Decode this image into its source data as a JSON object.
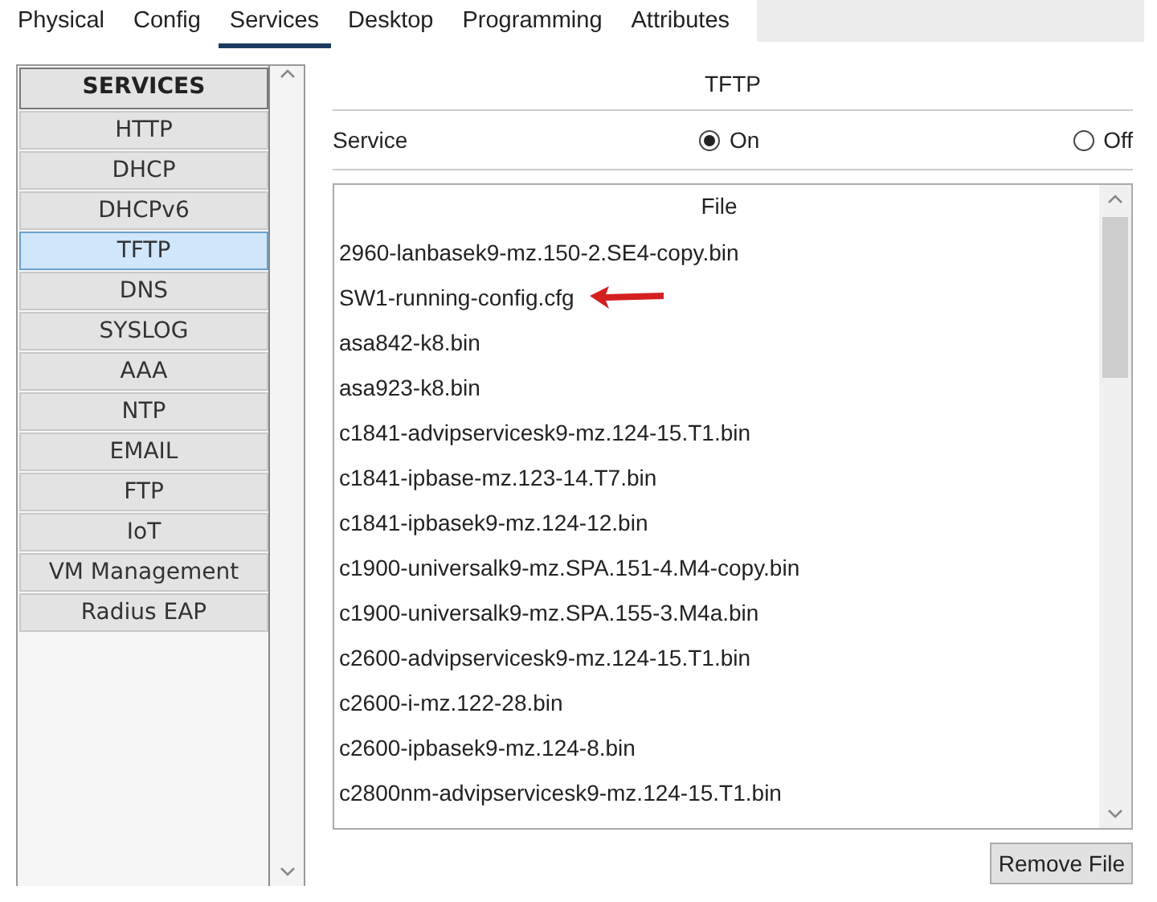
{
  "tabs": [
    {
      "label": "Physical",
      "selected": false
    },
    {
      "label": "Config",
      "selected": false
    },
    {
      "label": "Services",
      "selected": true
    },
    {
      "label": "Desktop",
      "selected": false
    },
    {
      "label": "Programming",
      "selected": false
    },
    {
      "label": "Attributes",
      "selected": false
    }
  ],
  "sidebar": {
    "heading": "SERVICES",
    "items": [
      {
        "label": "HTTP",
        "selected": false
      },
      {
        "label": "DHCP",
        "selected": false
      },
      {
        "label": "DHCPv6",
        "selected": false
      },
      {
        "label": "TFTP",
        "selected": true
      },
      {
        "label": "DNS",
        "selected": false
      },
      {
        "label": "SYSLOG",
        "selected": false
      },
      {
        "label": "AAA",
        "selected": false
      },
      {
        "label": "NTP",
        "selected": false
      },
      {
        "label": "EMAIL",
        "selected": false
      },
      {
        "label": "FTP",
        "selected": false
      },
      {
        "label": "IoT",
        "selected": false
      },
      {
        "label": "VM Management",
        "selected": false
      },
      {
        "label": "Radius EAP",
        "selected": false
      }
    ]
  },
  "panel": {
    "title": "TFTP",
    "service_label": "Service",
    "options": [
      {
        "label": "On",
        "selected": true
      },
      {
        "label": "Off",
        "selected": false
      }
    ],
    "file_list": {
      "header": "File",
      "files": [
        {
          "name": "2960-lanbasek9-mz.150-2.SE4-copy.bin",
          "arrow": false
        },
        {
          "name": "SW1-running-config.cfg",
          "arrow": true
        },
        {
          "name": "asa842-k8.bin",
          "arrow": false
        },
        {
          "name": "asa923-k8.bin",
          "arrow": false
        },
        {
          "name": "c1841-advipservicesk9-mz.124-15.T1.bin",
          "arrow": false
        },
        {
          "name": "c1841-ipbase-mz.123-14.T7.bin",
          "arrow": false
        },
        {
          "name": "c1841-ipbasek9-mz.124-12.bin",
          "arrow": false
        },
        {
          "name": "c1900-universalk9-mz.SPA.151-4.M4-copy.bin",
          "arrow": false
        },
        {
          "name": "c1900-universalk9-mz.SPA.155-3.M4a.bin",
          "arrow": false
        },
        {
          "name": "c2600-advipservicesk9-mz.124-15.T1.bin",
          "arrow": false
        },
        {
          "name": "c2600-i-mz.122-28.bin",
          "arrow": false
        },
        {
          "name": "c2600-ipbasek9-mz.124-8.bin",
          "arrow": false
        },
        {
          "name": "c2800nm-advipservicesk9-mz.124-15.T1.bin",
          "arrow": false
        }
      ]
    },
    "remove_button": "Remove File"
  }
}
